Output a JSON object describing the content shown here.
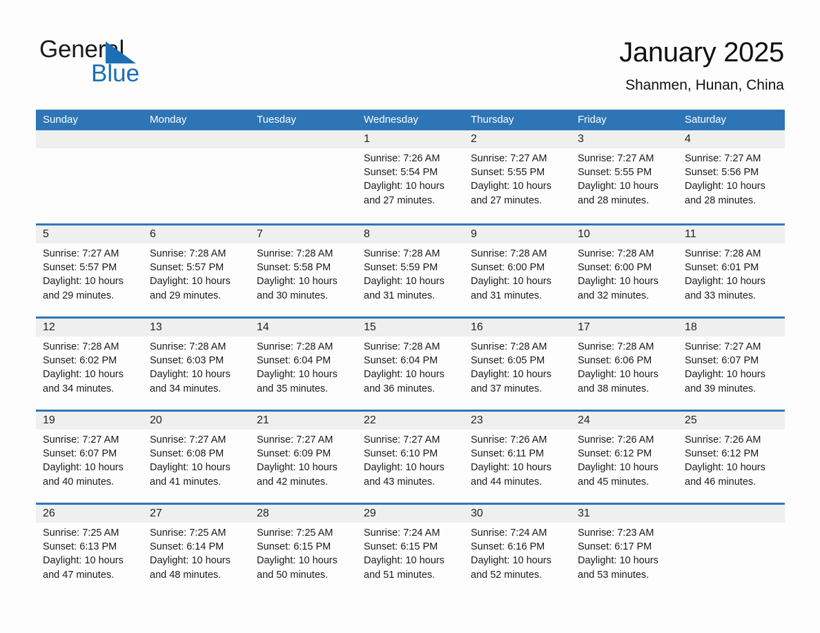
{
  "brand": {
    "name_part1": "General",
    "name_part2": "Blue",
    "accent_color": "#1b6fb5"
  },
  "header": {
    "month_title": "January 2025",
    "location": "Shanmen, Hunan, China"
  },
  "calendar": {
    "header_bg_color": "#2e75b6",
    "weekdays": [
      "Sunday",
      "Monday",
      "Tuesday",
      "Wednesday",
      "Thursday",
      "Friday",
      "Saturday"
    ],
    "weeks": [
      [
        {
          "day": "",
          "sunrise": "",
          "sunset": "",
          "daylight_line1": "",
          "daylight_line2": ""
        },
        {
          "day": "",
          "sunrise": "",
          "sunset": "",
          "daylight_line1": "",
          "daylight_line2": ""
        },
        {
          "day": "",
          "sunrise": "",
          "sunset": "",
          "daylight_line1": "",
          "daylight_line2": ""
        },
        {
          "day": "1",
          "sunrise": "Sunrise: 7:26 AM",
          "sunset": "Sunset: 5:54 PM",
          "daylight_line1": "Daylight: 10 hours",
          "daylight_line2": "and 27 minutes."
        },
        {
          "day": "2",
          "sunrise": "Sunrise: 7:27 AM",
          "sunset": "Sunset: 5:55 PM",
          "daylight_line1": "Daylight: 10 hours",
          "daylight_line2": "and 27 minutes."
        },
        {
          "day": "3",
          "sunrise": "Sunrise: 7:27 AM",
          "sunset": "Sunset: 5:55 PM",
          "daylight_line1": "Daylight: 10 hours",
          "daylight_line2": "and 28 minutes."
        },
        {
          "day": "4",
          "sunrise": "Sunrise: 7:27 AM",
          "sunset": "Sunset: 5:56 PM",
          "daylight_line1": "Daylight: 10 hours",
          "daylight_line2": "and 28 minutes."
        }
      ],
      [
        {
          "day": "5",
          "sunrise": "Sunrise: 7:27 AM",
          "sunset": "Sunset: 5:57 PM",
          "daylight_line1": "Daylight: 10 hours",
          "daylight_line2": "and 29 minutes."
        },
        {
          "day": "6",
          "sunrise": "Sunrise: 7:28 AM",
          "sunset": "Sunset: 5:57 PM",
          "daylight_line1": "Daylight: 10 hours",
          "daylight_line2": "and 29 minutes."
        },
        {
          "day": "7",
          "sunrise": "Sunrise: 7:28 AM",
          "sunset": "Sunset: 5:58 PM",
          "daylight_line1": "Daylight: 10 hours",
          "daylight_line2": "and 30 minutes."
        },
        {
          "day": "8",
          "sunrise": "Sunrise: 7:28 AM",
          "sunset": "Sunset: 5:59 PM",
          "daylight_line1": "Daylight: 10 hours",
          "daylight_line2": "and 31 minutes."
        },
        {
          "day": "9",
          "sunrise": "Sunrise: 7:28 AM",
          "sunset": "Sunset: 6:00 PM",
          "daylight_line1": "Daylight: 10 hours",
          "daylight_line2": "and 31 minutes."
        },
        {
          "day": "10",
          "sunrise": "Sunrise: 7:28 AM",
          "sunset": "Sunset: 6:00 PM",
          "daylight_line1": "Daylight: 10 hours",
          "daylight_line2": "and 32 minutes."
        },
        {
          "day": "11",
          "sunrise": "Sunrise: 7:28 AM",
          "sunset": "Sunset: 6:01 PM",
          "daylight_line1": "Daylight: 10 hours",
          "daylight_line2": "and 33 minutes."
        }
      ],
      [
        {
          "day": "12",
          "sunrise": "Sunrise: 7:28 AM",
          "sunset": "Sunset: 6:02 PM",
          "daylight_line1": "Daylight: 10 hours",
          "daylight_line2": "and 34 minutes."
        },
        {
          "day": "13",
          "sunrise": "Sunrise: 7:28 AM",
          "sunset": "Sunset: 6:03 PM",
          "daylight_line1": "Daylight: 10 hours",
          "daylight_line2": "and 34 minutes."
        },
        {
          "day": "14",
          "sunrise": "Sunrise: 7:28 AM",
          "sunset": "Sunset: 6:04 PM",
          "daylight_line1": "Daylight: 10 hours",
          "daylight_line2": "and 35 minutes."
        },
        {
          "day": "15",
          "sunrise": "Sunrise: 7:28 AM",
          "sunset": "Sunset: 6:04 PM",
          "daylight_line1": "Daylight: 10 hours",
          "daylight_line2": "and 36 minutes."
        },
        {
          "day": "16",
          "sunrise": "Sunrise: 7:28 AM",
          "sunset": "Sunset: 6:05 PM",
          "daylight_line1": "Daylight: 10 hours",
          "daylight_line2": "and 37 minutes."
        },
        {
          "day": "17",
          "sunrise": "Sunrise: 7:28 AM",
          "sunset": "Sunset: 6:06 PM",
          "daylight_line1": "Daylight: 10 hours",
          "daylight_line2": "and 38 minutes."
        },
        {
          "day": "18",
          "sunrise": "Sunrise: 7:27 AM",
          "sunset": "Sunset: 6:07 PM",
          "daylight_line1": "Daylight: 10 hours",
          "daylight_line2": "and 39 minutes."
        }
      ],
      [
        {
          "day": "19",
          "sunrise": "Sunrise: 7:27 AM",
          "sunset": "Sunset: 6:07 PM",
          "daylight_line1": "Daylight: 10 hours",
          "daylight_line2": "and 40 minutes."
        },
        {
          "day": "20",
          "sunrise": "Sunrise: 7:27 AM",
          "sunset": "Sunset: 6:08 PM",
          "daylight_line1": "Daylight: 10 hours",
          "daylight_line2": "and 41 minutes."
        },
        {
          "day": "21",
          "sunrise": "Sunrise: 7:27 AM",
          "sunset": "Sunset: 6:09 PM",
          "daylight_line1": "Daylight: 10 hours",
          "daylight_line2": "and 42 minutes."
        },
        {
          "day": "22",
          "sunrise": "Sunrise: 7:27 AM",
          "sunset": "Sunset: 6:10 PM",
          "daylight_line1": "Daylight: 10 hours",
          "daylight_line2": "and 43 minutes."
        },
        {
          "day": "23",
          "sunrise": "Sunrise: 7:26 AM",
          "sunset": "Sunset: 6:11 PM",
          "daylight_line1": "Daylight: 10 hours",
          "daylight_line2": "and 44 minutes."
        },
        {
          "day": "24",
          "sunrise": "Sunrise: 7:26 AM",
          "sunset": "Sunset: 6:12 PM",
          "daylight_line1": "Daylight: 10 hours",
          "daylight_line2": "and 45 minutes."
        },
        {
          "day": "25",
          "sunrise": "Sunrise: 7:26 AM",
          "sunset": "Sunset: 6:12 PM",
          "daylight_line1": "Daylight: 10 hours",
          "daylight_line2": "and 46 minutes."
        }
      ],
      [
        {
          "day": "26",
          "sunrise": "Sunrise: 7:25 AM",
          "sunset": "Sunset: 6:13 PM",
          "daylight_line1": "Daylight: 10 hours",
          "daylight_line2": "and 47 minutes."
        },
        {
          "day": "27",
          "sunrise": "Sunrise: 7:25 AM",
          "sunset": "Sunset: 6:14 PM",
          "daylight_line1": "Daylight: 10 hours",
          "daylight_line2": "and 48 minutes."
        },
        {
          "day": "28",
          "sunrise": "Sunrise: 7:25 AM",
          "sunset": "Sunset: 6:15 PM",
          "daylight_line1": "Daylight: 10 hours",
          "daylight_line2": "and 50 minutes."
        },
        {
          "day": "29",
          "sunrise": "Sunrise: 7:24 AM",
          "sunset": "Sunset: 6:15 PM",
          "daylight_line1": "Daylight: 10 hours",
          "daylight_line2": "and 51 minutes."
        },
        {
          "day": "30",
          "sunrise": "Sunrise: 7:24 AM",
          "sunset": "Sunset: 6:16 PM",
          "daylight_line1": "Daylight: 10 hours",
          "daylight_line2": "and 52 minutes."
        },
        {
          "day": "31",
          "sunrise": "Sunrise: 7:23 AM",
          "sunset": "Sunset: 6:17 PM",
          "daylight_line1": "Daylight: 10 hours",
          "daylight_line2": "and 53 minutes."
        },
        {
          "day": "",
          "sunrise": "",
          "sunset": "",
          "daylight_line1": "",
          "daylight_line2": ""
        }
      ]
    ]
  }
}
